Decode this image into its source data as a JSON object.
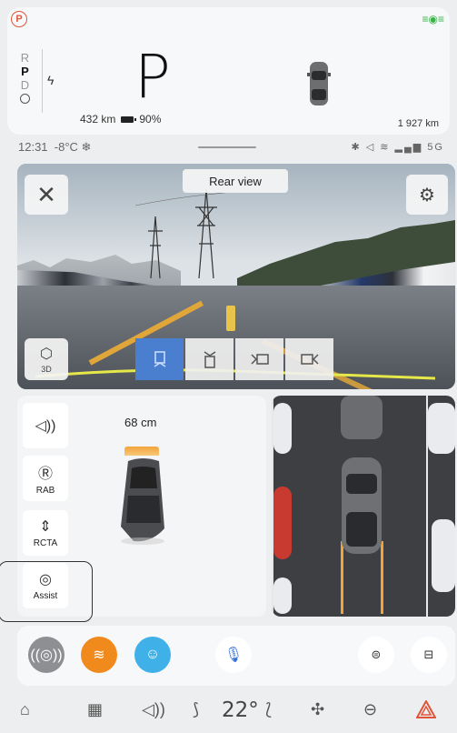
{
  "cluster": {
    "park_badge": "P",
    "gears": [
      "R",
      "P",
      "D"
    ],
    "active_gear": "P",
    "current_gear_big": "P",
    "range": "432 km",
    "battery_pct": "90%",
    "odometer": "1 927 km"
  },
  "status": {
    "time": "12:31",
    "temperature": "-8°C ❄",
    "network": "5G"
  },
  "camera": {
    "view_label": "Rear view",
    "btn_3d_label": "3D",
    "view_modes": [
      "rear-icon",
      "front-icon",
      "left-icon",
      "right-icon"
    ],
    "active_mode_index": 0
  },
  "parking": {
    "distance": "68 cm",
    "sound_label": "",
    "rab_label": "RAB",
    "rcta_label": "RCTA",
    "assist_label": "Assist"
  },
  "dock": {
    "apps": [
      "radio-app",
      "audible-app",
      "waze-app",
      "voice-assistant",
      "rear-defrost",
      "front-defrost"
    ]
  },
  "bottom_nav": {
    "temperature": "22°",
    "items": [
      "home-icon",
      "apps-grid-icon",
      "volume-icon",
      "seat-heat-icon",
      "seat-icon",
      "fan-icon",
      "car-icon",
      "hazard-icon"
    ]
  },
  "colors": {
    "accent_blue": "#4a7fd0",
    "warning_orange": "#f2a33a",
    "hazard_red": "#e0553a",
    "lamp_green": "#3bb34a"
  }
}
